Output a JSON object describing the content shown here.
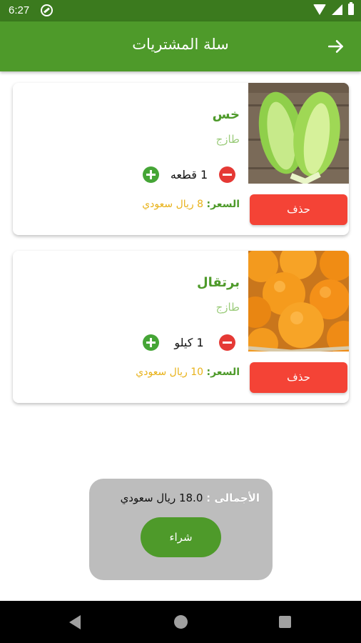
{
  "status": {
    "time": "6:27"
  },
  "header": {
    "title": "سلة المشتريات"
  },
  "cart": {
    "items": [
      {
        "name": "خس",
        "subtitle": "طازج",
        "quantity": "1 قطعه",
        "price_label": "السعر:",
        "price_value": "8 ريال سعودي",
        "delete_label": "حذف",
        "image": "lettuce-image"
      },
      {
        "name": "برتقال",
        "subtitle": "طازج",
        "quantity": "1 كيلو",
        "price_label": "السعر:",
        "price_value": "10 ريال سعودي",
        "delete_label": "حذف",
        "image": "oranges-image"
      }
    ]
  },
  "summary": {
    "total_label": "الأجمالى :",
    "total_value": "18.0 ريال سعودي",
    "buy_label": "شراء"
  },
  "colors": {
    "primary_green": "#4e9a2a",
    "status_green": "#3b7a1e",
    "delete_red": "#f44336",
    "price_yellow": "#e8b21a",
    "panel_grey": "#bdbdbd"
  }
}
